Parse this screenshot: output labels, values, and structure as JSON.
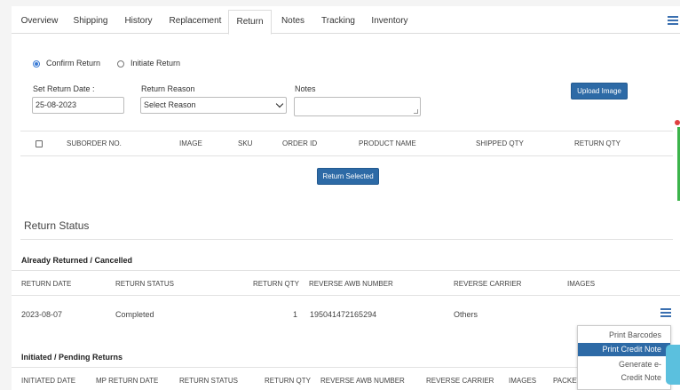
{
  "tabs": [
    {
      "label": "Overview"
    },
    {
      "label": "Shipping"
    },
    {
      "label": "History"
    },
    {
      "label": "Replacement"
    },
    {
      "label": "Return",
      "active": true
    },
    {
      "label": "Notes"
    },
    {
      "label": "Tracking"
    },
    {
      "label": "Inventory"
    }
  ],
  "return_form": {
    "radio_confirm": "Confirm Return",
    "radio_initiate": "Initiate Return",
    "set_date_label": "Set Return Date :",
    "date_value": "25-08-2023",
    "reason_label": "Return Reason",
    "reason_value": "Select Reason",
    "notes_label": "Notes",
    "notes_value": "",
    "upload_button": "Upload Image",
    "return_selected_button": "Return Selected"
  },
  "suborder_table": {
    "headers": [
      "SUBORDER NO.",
      "IMAGE",
      "SKU",
      "ORDER ID",
      "PRODUCT NAME",
      "SHIPPED QTY",
      "RETURN QTY"
    ]
  },
  "return_status": {
    "title": "Return Status",
    "already_title": "Already Returned / Cancelled",
    "already_headers": [
      "RETURN DATE",
      "RETURN STATUS",
      "RETURN QTY",
      "REVERSE AWB NUMBER",
      "REVERSE CARRIER",
      "IMAGES"
    ],
    "already_row": {
      "date": "2023-08-07",
      "status": "Completed",
      "qty": "1",
      "awb": "195041472165294",
      "carrier": "Others"
    },
    "pending_title": "Initiated / Pending Returns",
    "pending_headers": [
      "INITIATED DATE",
      "MP RETURN DATE",
      "RETURN STATUS",
      "RETURN QTY",
      "REVERSE AWB NUMBER",
      "REVERSE CARRIER",
      "IMAGES",
      "PACKET"
    ]
  },
  "row_menu": {
    "items": [
      {
        "label": "Print Barcodes"
      },
      {
        "label": "Print Credit Note",
        "active": true
      },
      {
        "label": "Generate e-"
      },
      {
        "label": "Credit Note"
      }
    ]
  },
  "colors": {
    "primary": "#2d6aa6",
    "accent_green": "#3cb44b",
    "chat": "#5bc0de"
  }
}
